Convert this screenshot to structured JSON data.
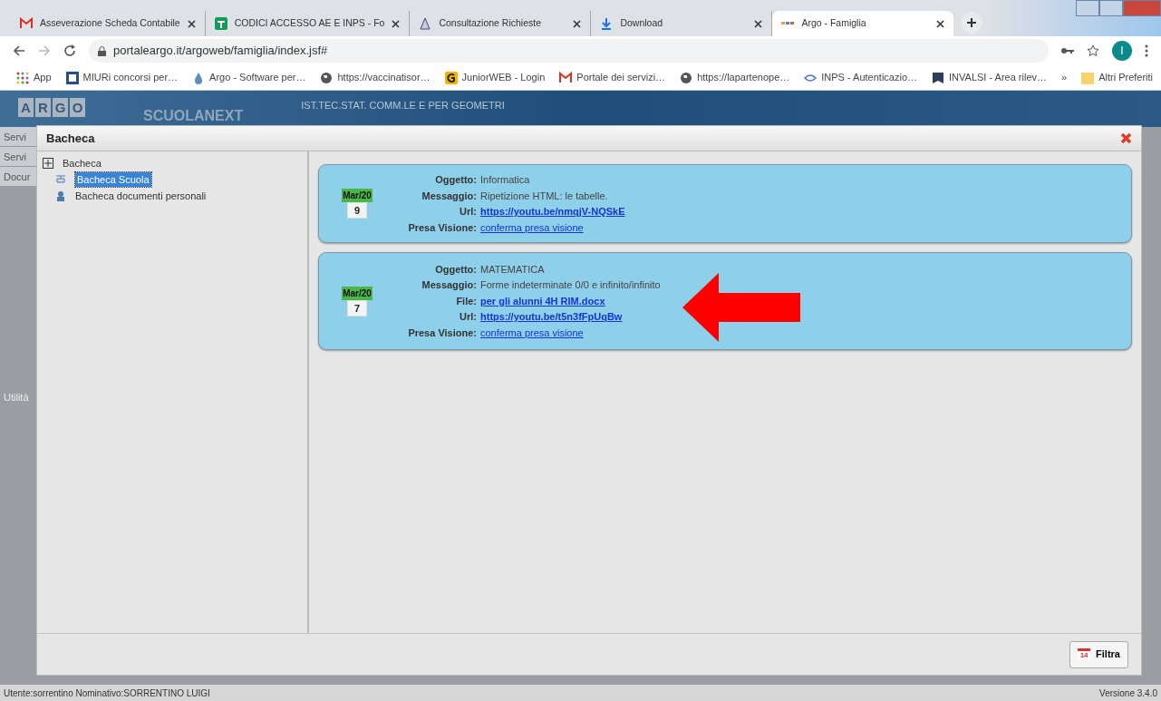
{
  "browser": {
    "tabs": [
      {
        "title": "Asseverazione Scheda Contabile",
        "selected": false
      },
      {
        "title": "CODICI ACCESSO AE E INPS - Fo",
        "selected": false
      },
      {
        "title": "Consultazione Richieste",
        "selected": false
      },
      {
        "title": "Download",
        "selected": false
      },
      {
        "title": "Argo - Famiglia",
        "selected": true
      }
    ],
    "address": "portaleargo.it/argoweb/famiglia/index.jsf#",
    "bookmarks": [
      {
        "label": "App"
      },
      {
        "label": "MIURi concorsi per…"
      },
      {
        "label": "Argo - Software per…"
      },
      {
        "label": "https://vaccinatisor…"
      },
      {
        "label": "JuniorWEB - Login"
      },
      {
        "label": "Portale dei servizi…"
      },
      {
        "label": "https://lapartenope…"
      },
      {
        "label": "INPS - Autenticazio…"
      },
      {
        "label": "INVALSI - Area rilev…"
      }
    ],
    "more_bookmarks": "»",
    "other_bookmarks": "Altri Preferiti",
    "profile_initial": "I"
  },
  "app": {
    "logo": [
      "A",
      "R",
      "G",
      "O"
    ],
    "product": "SCUOLANEXT",
    "school": "IST.TEC.STAT. COMM.LE E PER GEOMETRI",
    "sidebar": [
      "Servi",
      "Servi",
      "Docur"
    ],
    "sidebar_label": "Utilità"
  },
  "dialog": {
    "title": "Bacheca",
    "tree": {
      "label": "Bacheca",
      "expanded": true,
      "children": [
        {
          "label": "Bacheca Scuola",
          "selected": true
        },
        {
          "label": "Bacheca documenti personali",
          "selected": false
        }
      ]
    },
    "notices": [
      {
        "month": "Mar/20",
        "day": "9",
        "fields": [
          {
            "label": "Oggetto:",
            "value": "Informatica",
            "kind": "text"
          },
          {
            "label": "Messaggio:",
            "value": "Ripetizione HTML: le tabelle.",
            "kind": "text"
          },
          {
            "label": "Url:",
            "value": "https://youtu.be/nmqjV-NQSkE",
            "kind": "strong-link"
          },
          {
            "label": "Presa Visione:",
            "value": "conferma presa visione",
            "kind": "link"
          }
        ]
      },
      {
        "month": "Mar/20",
        "day": "7",
        "fields": [
          {
            "label": "Oggetto:",
            "value": "MATEMATICA",
            "kind": "text"
          },
          {
            "label": "Messaggio:",
            "value": "Forme indeterminate 0/0 e infinito/infinito",
            "kind": "text"
          },
          {
            "label": "File:",
            "value": "per gli alunni 4H RIM.docx",
            "kind": "strong-link"
          },
          {
            "label": "Url:",
            "value": "https://youtu.be/t5n3fFpUqBw",
            "kind": "strong-link"
          },
          {
            "label": "Presa Visione:",
            "value": "conferma presa visione",
            "kind": "link"
          }
        ]
      }
    ],
    "filter_button": "Filtra",
    "filter_icon_text": "14"
  },
  "status_bar": {
    "user": "Utente:sorrentino Nominativo:SORRENTINO LUIGI",
    "version": "Versione 3.4.0"
  }
}
